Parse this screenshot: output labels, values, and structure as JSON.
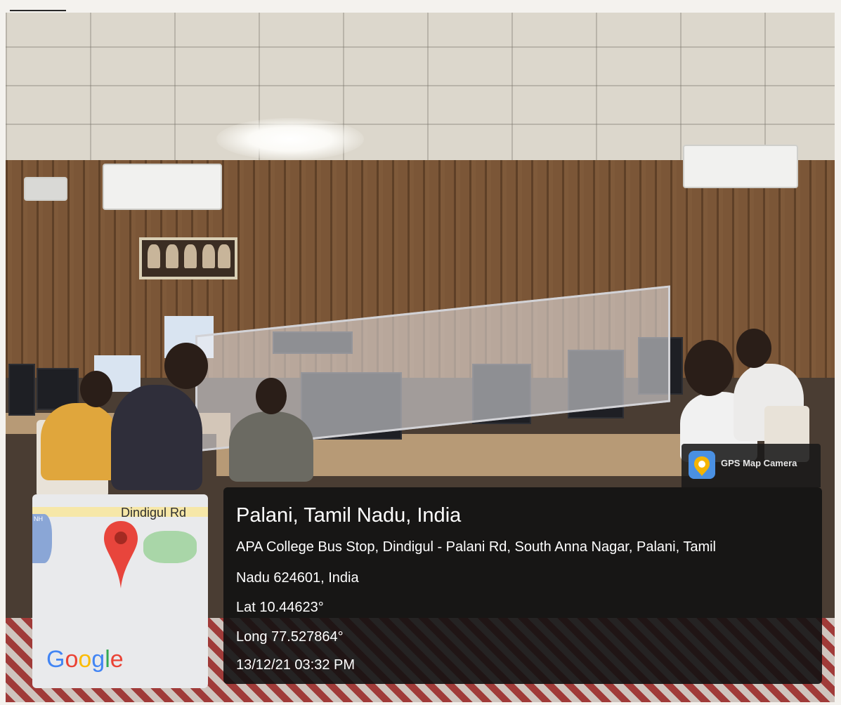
{
  "overlay": {
    "app_name": "GPS Map Camera",
    "place": "Palani, Tamil Nadu, India",
    "address_line1": "APA College Bus Stop, Dindigul - Palani Rd, South Anna Nagar, Palani, Tamil",
    "address_line2": "Nadu 624601, India",
    "latitude": "Lat 10.44623°",
    "longitude": "Long 77.527864°",
    "timestamp": "13/12/21 03:32 PM"
  },
  "map": {
    "road_label": "Dindigul Rd",
    "route_shield": "NH",
    "provider_logo": [
      "G",
      "o",
      "o",
      "g",
      "l",
      "e"
    ],
    "pin_color": "#e8453c",
    "icons": [
      "map-pin-icon",
      "gps-map-camera-icon"
    ]
  },
  "scene": {
    "colors": {
      "wall": "#7b5637",
      "ceiling": "#dcd7cc",
      "overlay": "#121212"
    }
  }
}
